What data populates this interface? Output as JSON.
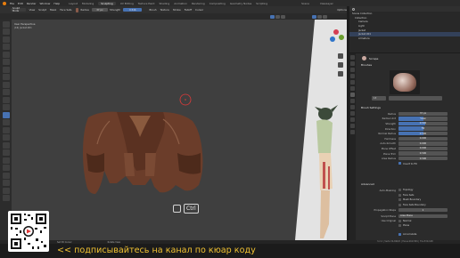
{
  "menubar": {
    "items": [
      "File",
      "Edit",
      "Render",
      "Window",
      "Help"
    ],
    "workspaces": [
      "Layout",
      "Modeling",
      "Sculpting",
      "UV Editing",
      "Texture Paint",
      "Shading",
      "Animation",
      "Rendering",
      "Compositing",
      "Geometry Nodes",
      "Scripting"
    ],
    "active_workspace": "Sculpting",
    "scene_label": "Scene",
    "view_layer_label": "ViewLayer"
  },
  "tool_header": {
    "mode": "Sculpt Mode",
    "view": "View",
    "sculpt": "Sculpt",
    "mask": "Mask",
    "face_sets": "Face Sets",
    "radius_label": "Radius",
    "radius_value": "37 px",
    "strength_label": "Strength",
    "strength_value": "0.546",
    "brush_settings": "Brush",
    "texture": "Texture",
    "stroke": "Stroke",
    "falloff": "Falloff",
    "cursor": "Cursor",
    "options": "Options"
  },
  "viewport": {
    "info_line1": "User Perspective",
    "info_line2": "(16) Jacket.001"
  },
  "key_hint": {
    "key": "Ctrl"
  },
  "outliner": {
    "title": "Scene Collection",
    "rows": [
      "Collection",
      "Camera",
      "Light",
      "Jacket",
      "Jacket.001",
      "Armature"
    ],
    "selected_index": 4
  },
  "properties": {
    "tool_title": "Scrape",
    "brushes_title": "Brushes",
    "brush_number": "13",
    "brush_settings_title": "Brush Settings",
    "rows": [
      {
        "label": "Radius",
        "value": "37 px",
        "fill": 0.0
      },
      {
        "label": "Radius Unit",
        "value": "View",
        "fill": 0.5
      },
      {
        "label": "Strength",
        "value": "0.546",
        "fill": 0.55
      },
      {
        "label": "Direction",
        "value": "Fill",
        "fill": 0.5
      },
      {
        "label": "Normal Radius",
        "value": "0.500",
        "fill": 0.5
      },
      {
        "label": "Hardness",
        "value": "0.000",
        "fill": 0.0
      },
      {
        "label": "Auto-Smooth",
        "value": "0.000",
        "fill": 0.0
      },
      {
        "label": "Plane Offset",
        "value": "0.000",
        "fill": 0.0
      },
      {
        "label": "Plane Trim",
        "value": "0.500",
        "fill": 0.0
      },
      {
        "label": "Area Radius",
        "value": "0.500",
        "fill": 0.0
      }
    ],
    "invert_to_fill": "Invert to Fill",
    "advanced_title": "Advanced",
    "auto_masking_label": "Auto-Masking",
    "auto_masking_options": [
      "Topology",
      "Face Sets",
      "Mesh Boundary",
      "Face Sets Boundary"
    ],
    "propagation_steps_label": "Propagation Steps",
    "propagation_steps_value": "1",
    "sculpt_plane_label": "Sculpt Plane",
    "sculpt_plane_value": "Area Plane",
    "use_original_label": "Use Original",
    "use_original_options": [
      "Normal",
      "Plane"
    ],
    "accumulate": "Accumulate"
  },
  "statusbar": {
    "left_hint": "Set 3D Cursor",
    "mid_hint": "Rotate View",
    "version": "3.2.2 | Verts:34,696/0 | Faces:269,584 | Tris:539,168"
  },
  "caption": "<< подписывайтесь на канал по кюар коду",
  "colors": {
    "accent": "#4772b3",
    "caption": "#f1c232",
    "jacket": "#6b3d2a",
    "brush_circle": "#e03a3a"
  }
}
